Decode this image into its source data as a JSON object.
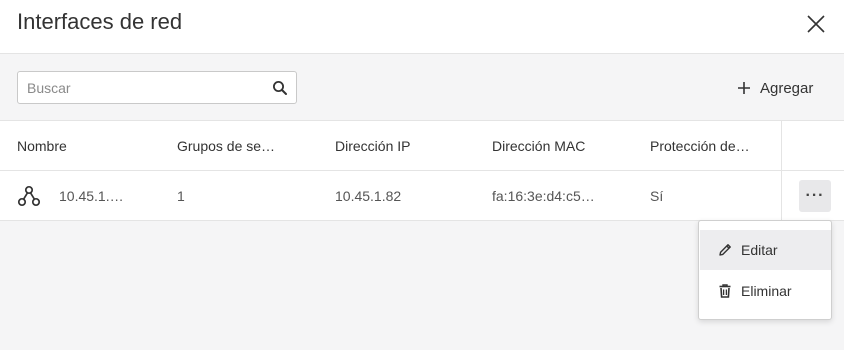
{
  "dialog": {
    "title": "Interfaces de red"
  },
  "toolbar": {
    "search_placeholder": "Buscar",
    "add_label": "Agregar"
  },
  "table": {
    "columns": [
      "Nombre",
      "Grupos de se…",
      "Dirección IP",
      "Dirección MAC",
      "Protección de…"
    ],
    "rows": [
      {
        "name": "10.45.1.…",
        "groups": "1",
        "ip": "10.45.1.82",
        "mac": "fa:16:3e:d4:c5…",
        "protection": "Sí"
      }
    ]
  },
  "row_menu": {
    "items": [
      {
        "label": "Editar",
        "icon": "pencil-icon"
      },
      {
        "label": "Eliminar",
        "icon": "trash-icon"
      }
    ]
  },
  "colors": {
    "background": "#f5f5f6",
    "surface": "#ffffff",
    "border": "#e4e4e4",
    "text": "#333333"
  }
}
